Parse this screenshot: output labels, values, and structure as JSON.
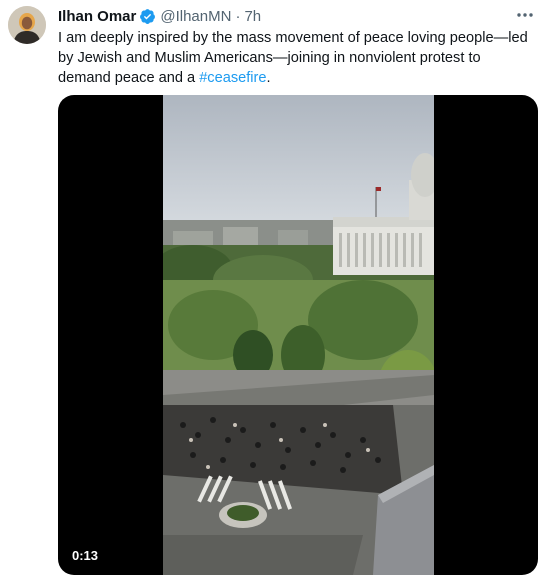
{
  "author": {
    "name": "Ilhan Omar",
    "handle": "@IlhanMN",
    "separator": "·",
    "time": "7h",
    "verified_color": "#1d9bf0"
  },
  "tweet": {
    "text_before": "I am deeply inspired by the mass movement of peace loving people—led by Jewish and Muslim Americans—joining in nonviolent protest to demand peace and a ",
    "hashtag": "#ceasefire",
    "text_after": "."
  },
  "video": {
    "duration": "0:13"
  },
  "icons": {
    "more": "more-options-icon",
    "verified": "verified-badge-icon"
  },
  "colors": {
    "link": "#1d9bf0",
    "secondary_text": "#536471",
    "primary_text": "#0f1419"
  }
}
